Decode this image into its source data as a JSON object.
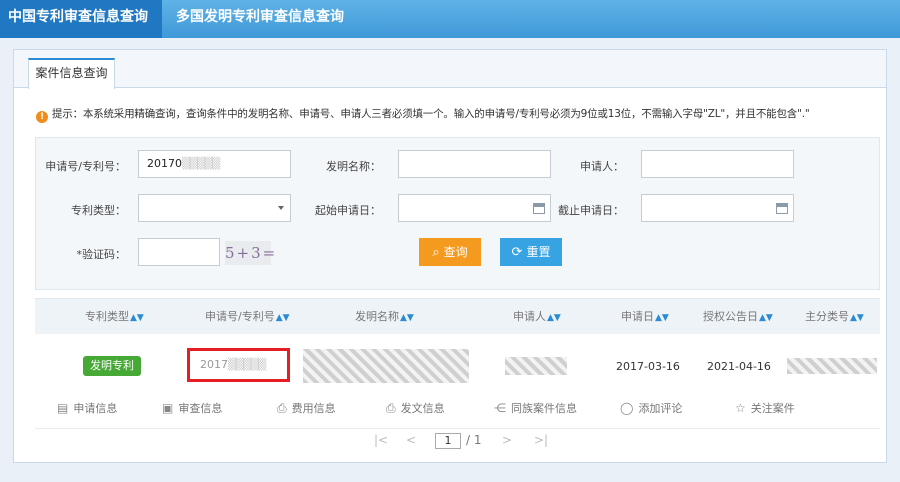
{
  "nav": {
    "tabs": [
      {
        "label": "中国专利审查信息查询"
      },
      {
        "label": "多国发明专利审查信息查询"
      }
    ]
  },
  "panel": {
    "tab_label": "案件信息查询",
    "tip": "提示：本系统采用精确查询，查询条件中的发明名称、申请号、申请人三者必须填一个。输入的申请号/专利号必须为9位或13位，不需输入字母\"ZL\"，并且不能包含\".\""
  },
  "form": {
    "app_no_label": "申请号/专利号：",
    "app_no_value": "20170",
    "invention_name_label": "发明名称：",
    "applicant_label": "申请人：",
    "patent_type_label": "专利类型：",
    "start_date_label": "起始申请日：",
    "end_date_label": "截止申请日：",
    "captcha_label": "*验证码：",
    "captcha_image_text": "5+3=",
    "search_label": "查询",
    "reset_label": "重置"
  },
  "table": {
    "headers": [
      "专利类型",
      "申请号/专利号",
      "发明名称",
      "申请人",
      "申请日",
      "授权公告日",
      "主分类号"
    ],
    "row": {
      "type_badge": "发明专利",
      "app_no": "2017",
      "apply_date": "2017-03-16",
      "grant_date": "2021-04-16"
    },
    "actions": [
      "申请信息",
      "审查信息",
      "费用信息",
      "发文信息",
      "同族案件信息",
      "添加评论",
      "关注案件"
    ]
  },
  "pager": {
    "first": "|<",
    "prev": "<",
    "page": "1",
    "total": "/ 1",
    "next": ">",
    "last": ">|"
  },
  "colors": {
    "nav_bg": "#3f99d8",
    "nav_active": "#1f78c1",
    "search_button": "#f39a1f",
    "reset_button": "#37a3e3",
    "badge": "#46a835",
    "highlight_box": "#e31e24"
  }
}
